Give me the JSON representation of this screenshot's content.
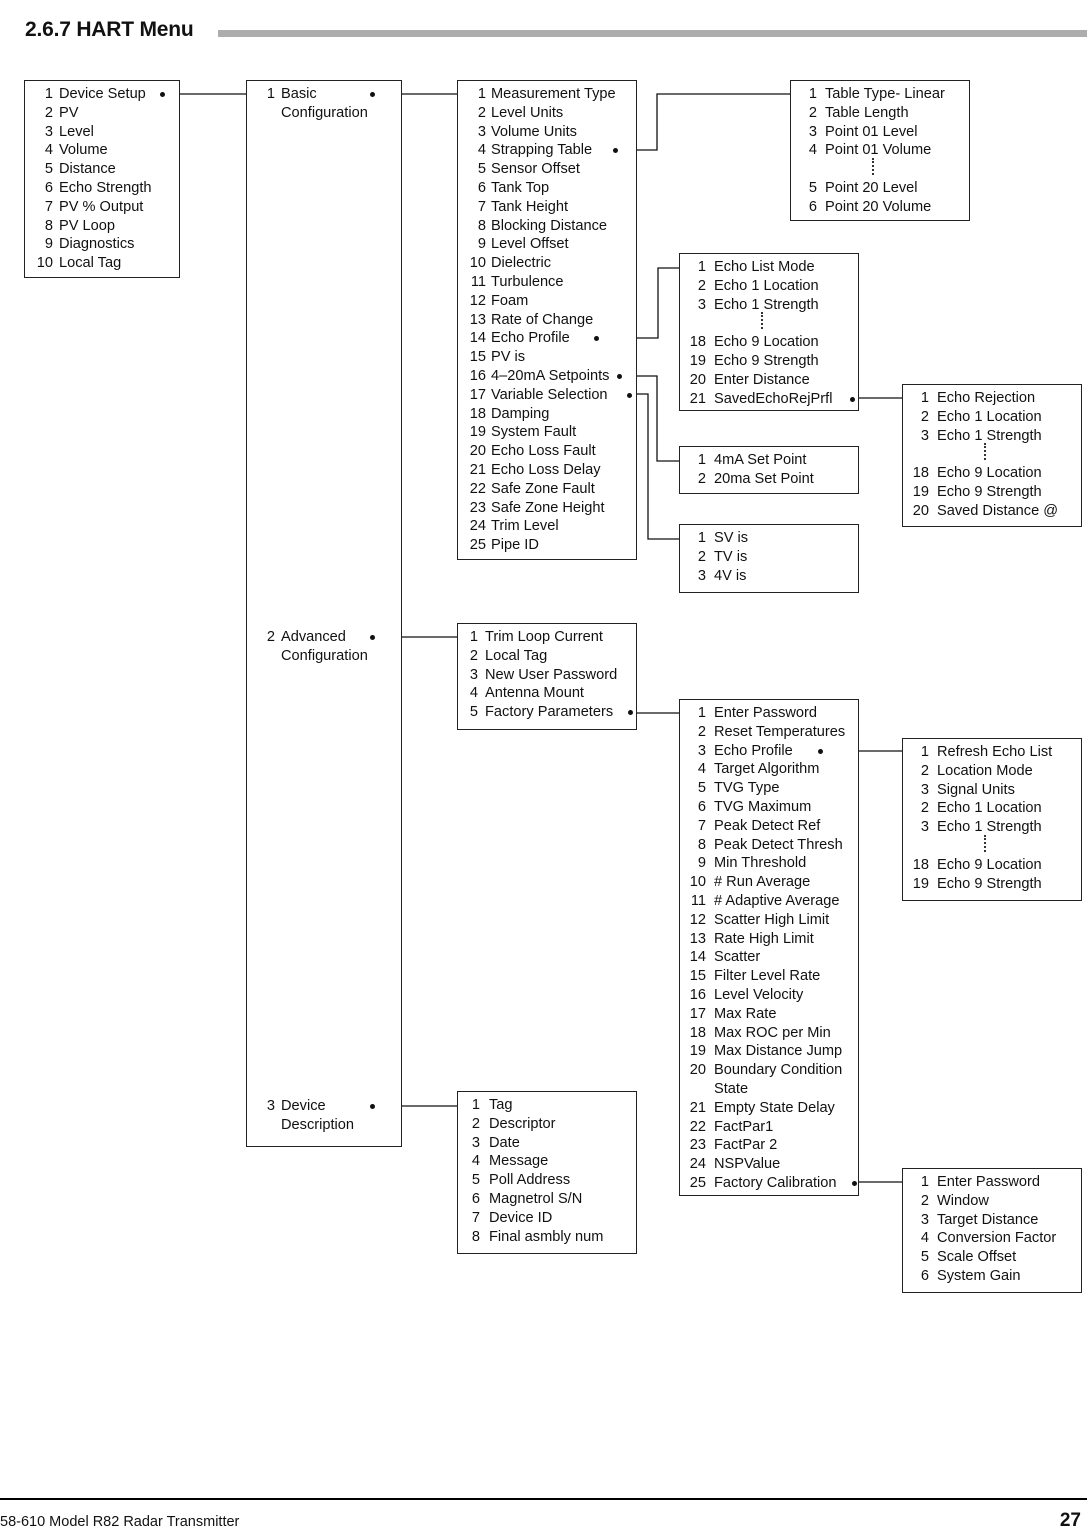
{
  "page": {
    "section_title": "2.6.7 HART Menu",
    "footer_doc": "58-610 Model R82 Radar Transmitter",
    "footer_page": "27"
  },
  "menus": {
    "root": {
      "items": [
        {
          "n": "1",
          "label": "Device Setup",
          "branch": true
        },
        {
          "n": "2",
          "label": "PV"
        },
        {
          "n": "3",
          "label": "Level"
        },
        {
          "n": "4",
          "label": "Volume"
        },
        {
          "n": "5",
          "label": "Distance"
        },
        {
          "n": "6",
          "label": "Echo Strength"
        },
        {
          "n": "7",
          "label": "PV % Output"
        },
        {
          "n": "8",
          "label": "PV Loop"
        },
        {
          "n": "9",
          "label": "Diagnostics"
        },
        {
          "n": "10",
          "label": "Local Tag"
        }
      ]
    },
    "device_setup": {
      "items": [
        {
          "n": "1",
          "label": "Basic",
          "label2": "Configuration",
          "branch": true
        },
        {
          "n": "2",
          "label": "Advanced",
          "label2": "Configuration",
          "branch": true
        },
        {
          "n": "3",
          "label": "Device",
          "label2": "Description",
          "branch": true
        }
      ]
    },
    "basic_config": {
      "items": [
        {
          "n": "1",
          "label": "Measurement Type"
        },
        {
          "n": "2",
          "label": "Level Units"
        },
        {
          "n": "3",
          "label": "Volume Units"
        },
        {
          "n": "4",
          "label": "Strapping Table",
          "branch": true
        },
        {
          "n": "5",
          "label": "Sensor Offset"
        },
        {
          "n": "6",
          "label": "Tank Top"
        },
        {
          "n": "7",
          "label": "Tank Height"
        },
        {
          "n": "8",
          "label": "Blocking Distance"
        },
        {
          "n": "9",
          "label": "Level Offset"
        },
        {
          "n": "10",
          "label": "Dielectric"
        },
        {
          "n": "11",
          "label": "Turbulence"
        },
        {
          "n": "12",
          "label": "Foam"
        },
        {
          "n": "13",
          "label": "Rate of Change"
        },
        {
          "n": "14",
          "label": "Echo Profile",
          "branch": true
        },
        {
          "n": "15",
          "label": "PV is"
        },
        {
          "n": "16",
          "label": "4–20mA Setpoints",
          "branch": true
        },
        {
          "n": "17",
          "label": "Variable Selection",
          "branch": true
        },
        {
          "n": "18",
          "label": "Damping"
        },
        {
          "n": "19",
          "label": "System Fault"
        },
        {
          "n": "20",
          "label": "Echo Loss Fault"
        },
        {
          "n": "21",
          "label": "Echo Loss Delay"
        },
        {
          "n": "22",
          "label": "Safe Zone Fault"
        },
        {
          "n": "23",
          "label": "Safe Zone Height"
        },
        {
          "n": "24",
          "label": "Trim Level"
        },
        {
          "n": "25",
          "label": "Pipe ID"
        }
      ]
    },
    "strapping_table": {
      "items": [
        {
          "n": "1",
          "label": "Table Type- Linear"
        },
        {
          "n": "2",
          "label": "Table Length"
        },
        {
          "n": "3",
          "label": "Point 01 Level"
        },
        {
          "n": "4",
          "label": "Point 01 Volume"
        },
        {
          "ellipsis": true
        },
        {
          "n": "5",
          "label": "Point 20 Level"
        },
        {
          "n": "6",
          "label": "Point 20 Volume"
        }
      ]
    },
    "echo_profile": {
      "items": [
        {
          "n": "1",
          "label": "Echo List Mode"
        },
        {
          "n": "2",
          "label": "Echo 1 Location"
        },
        {
          "n": "3",
          "label": "Echo 1 Strength"
        },
        {
          "ellipsis": true
        },
        {
          "n": "18",
          "label": "Echo 9 Location"
        },
        {
          "n": "19",
          "label": "Echo 9 Strength"
        },
        {
          "n": "20",
          "label": "Enter Distance"
        },
        {
          "n": "21",
          "label": "SavedEchoRejPrfl",
          "branch": true
        }
      ]
    },
    "saved_echo_rej": {
      "items": [
        {
          "n": "1",
          "label": "Echo Rejection"
        },
        {
          "n": "2",
          "label": "Echo 1 Location"
        },
        {
          "n": "3",
          "label": "Echo 1 Strength"
        },
        {
          "ellipsis": true
        },
        {
          "n": "18",
          "label": "Echo 9 Location"
        },
        {
          "n": "19",
          "label": "Echo 9 Strength"
        },
        {
          "n": "20",
          "label": "Saved Distance @"
        }
      ]
    },
    "setpoints": {
      "items": [
        {
          "n": "1",
          "label": "4mA Set Point"
        },
        {
          "n": "2",
          "label": "20ma Set Point"
        }
      ]
    },
    "variable_selection": {
      "items": [
        {
          "n": "1",
          "label": "SV is"
        },
        {
          "n": "2",
          "label": "TV is"
        },
        {
          "n": "3",
          "label": "4V is"
        }
      ]
    },
    "advanced_config": {
      "items": [
        {
          "n": "1",
          "label": "Trim Loop Current"
        },
        {
          "n": "2",
          "label": "Local Tag"
        },
        {
          "n": "3",
          "label": "New User Password"
        },
        {
          "n": "4",
          "label": "Antenna Mount"
        },
        {
          "n": "5",
          "label": "Factory Parameters",
          "branch": true
        }
      ]
    },
    "factory_params": {
      "items": [
        {
          "n": "1",
          "label": "Enter Password"
        },
        {
          "n": "2",
          "label": "Reset Temperatures"
        },
        {
          "n": "3",
          "label": "Echo Profile",
          "branch": true
        },
        {
          "n": "4",
          "label": "Target Algorithm"
        },
        {
          "n": "5",
          "label": "TVG Type"
        },
        {
          "n": "6",
          "label": "TVG Maximum"
        },
        {
          "n": "7",
          "label": "Peak Detect Ref"
        },
        {
          "n": "8",
          "label": "Peak Detect Thresh"
        },
        {
          "n": "9",
          "label": "Min Threshold"
        },
        {
          "n": "10",
          "label": "# Run Average"
        },
        {
          "n": "11",
          "label": "# Adaptive Average"
        },
        {
          "n": "12",
          "label": "Scatter High Limit"
        },
        {
          "n": "13",
          "label": "Rate High Limit"
        },
        {
          "n": "14",
          "label": "Scatter"
        },
        {
          "n": "15",
          "label": "Filter Level Rate"
        },
        {
          "n": "16",
          "label": "Level Velocity"
        },
        {
          "n": "17",
          "label": "Max Rate"
        },
        {
          "n": "18",
          "label": "Max ROC per Min"
        },
        {
          "n": "19",
          "label": "Max Distance Jump"
        },
        {
          "n": "20",
          "label": "Boundary Condition",
          "label2": "State"
        },
        {
          "n": "21",
          "label": "Empty State Delay"
        },
        {
          "n": "22",
          "label": "FactPar1"
        },
        {
          "n": "23",
          "label": "FactPar 2"
        },
        {
          "n": "24",
          "label": "NSPValue"
        },
        {
          "n": "25",
          "label": "Factory Calibration",
          "branch": true
        }
      ]
    },
    "factory_echo_profile": {
      "items": [
        {
          "n": "1",
          "label": "Refresh Echo List"
        },
        {
          "n": "2",
          "label": "Location Mode"
        },
        {
          "n": "3",
          "label": "Signal Units"
        },
        {
          "n": "2",
          "label": "Echo 1 Location"
        },
        {
          "n": "3",
          "label": "Echo 1 Strength"
        },
        {
          "ellipsis": true
        },
        {
          "n": "18",
          "label": "Echo 9 Location"
        },
        {
          "n": "19",
          "label": "Echo 9 Strength"
        }
      ]
    },
    "factory_calibration": {
      "items": [
        {
          "n": "1",
          "label": "Enter Password"
        },
        {
          "n": "2",
          "label": "Window"
        },
        {
          "n": "3",
          "label": "Target Distance"
        },
        {
          "n": "4",
          "label": "Conversion Factor"
        },
        {
          "n": "5",
          "label": "Scale Offset"
        },
        {
          "n": "6",
          "label": "System Gain"
        }
      ]
    },
    "device_description": {
      "items": [
        {
          "n": "1",
          "label": "Tag"
        },
        {
          "n": "2",
          "label": "Descriptor"
        },
        {
          "n": "3",
          "label": "Date"
        },
        {
          "n": "4",
          "label": "Message"
        },
        {
          "n": "5",
          "label": "Poll Address"
        },
        {
          "n": "6",
          "label": "Magnetrol S/N"
        },
        {
          "n": "7",
          "label": "Device ID"
        },
        {
          "n": "8",
          "label": "Final asmbly num"
        }
      ]
    }
  }
}
